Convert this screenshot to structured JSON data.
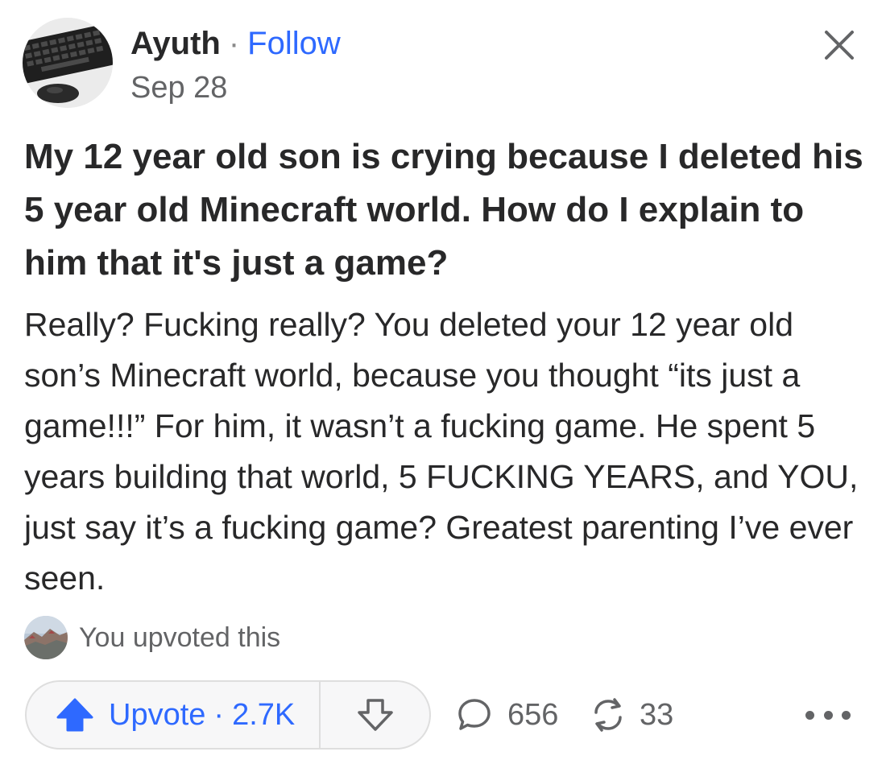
{
  "header": {
    "author_name": "Ayuth",
    "separator": "·",
    "follow_label": "Follow",
    "date": "Sep 28",
    "avatar_icon": "keyboard-and-mouse-photo",
    "close_icon": "close-icon"
  },
  "question": {
    "title": "My 12 year old son is crying because I deleted his 5 year old Minecraft world. How do I explain to him that it's just a game?"
  },
  "answer": {
    "body": "Really? Fucking really? You deleted your 12 year old son’s Minecraft world, because you thought “its just a game!!!” For him, it wasn’t a fucking game. He spent 5 years building that world, 5 FUCKING YEARS, and YOU, just say it’s a fucking game? Greatest parenting I’ve ever seen."
  },
  "upvote_note": {
    "text": "You upvoted this"
  },
  "actions": {
    "upvote_label": "Upvote",
    "separator": "·",
    "upvote_count": "2.7K",
    "comment_count": "656",
    "share_count": "33"
  },
  "colors": {
    "accent": "#2e69ff",
    "text": "#282829",
    "muted": "#636466",
    "pill_border": "#dedede",
    "pill_bg": "#f7f7f8"
  }
}
